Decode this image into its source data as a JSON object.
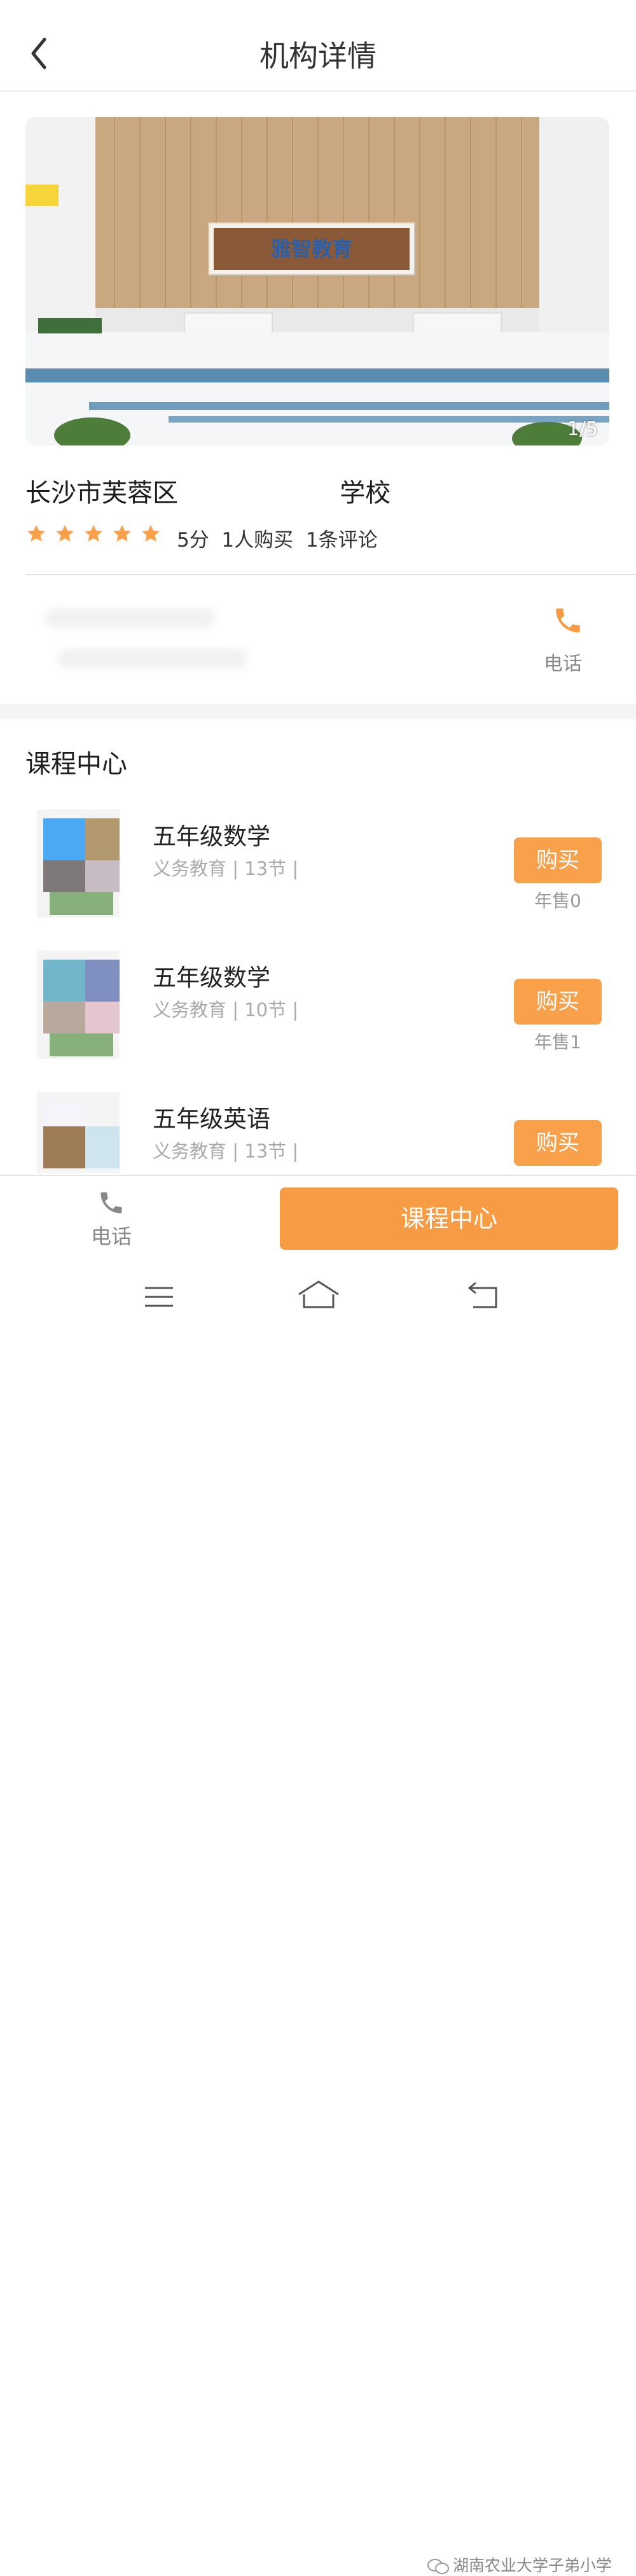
{
  "header": {
    "title": "机构详情"
  },
  "banner": {
    "counter": "1/5",
    "sign_text": "雅智教育"
  },
  "school": {
    "name": "长沙市芙蓉区                    学校",
    "rating_value": 5,
    "rating_text": "5分  1人购买  1条评论"
  },
  "contact": {
    "phone_label": "电话"
  },
  "course_center": {
    "title": "课程中心",
    "courses": [
      {
        "title": "五年级数学",
        "meta": "义务教育 | 13节 |",
        "buy": "购买",
        "sales": "年售0"
      },
      {
        "title": "五年级数学",
        "meta": "义务教育 | 10节 |",
        "buy": "购买",
        "sales": "年售1"
      },
      {
        "title": "五年级英语",
        "meta": "义务教育 | 13节 |",
        "buy": "购买",
        "sales": ""
      }
    ]
  },
  "bottom_bar": {
    "phone_label": "电话",
    "course_center_label": "课程中心"
  },
  "watermark": "湖南农业大学子弟小学",
  "colors": {
    "accent": "#f79c45",
    "star": "#f9a04b",
    "muted": "#888888"
  }
}
